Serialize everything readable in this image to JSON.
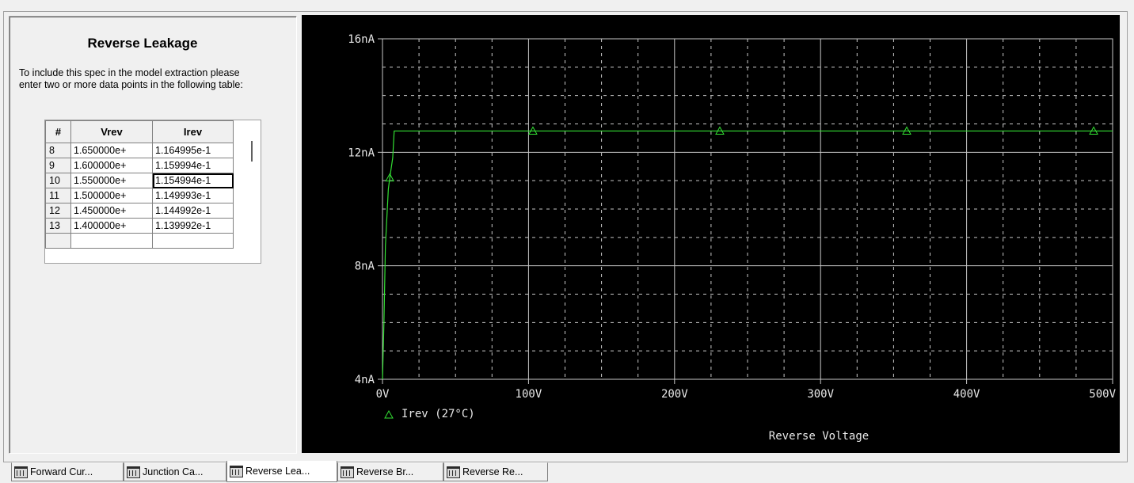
{
  "spec_panel": {
    "title": "Reverse Leakage",
    "description": "To include this spec in the model extraction please enter two or more data points in the following table:"
  },
  "data_table": {
    "columns": [
      "#",
      "Vrev",
      "Irev"
    ],
    "rows": [
      {
        "idx": "8",
        "vrev": "1.650000e+",
        "irev": "1.164995e-1"
      },
      {
        "idx": "9",
        "vrev": "1.600000e+",
        "irev": "1.159994e-1"
      },
      {
        "idx": "10",
        "vrev": "1.550000e+",
        "irev": "1.154994e-1"
      },
      {
        "idx": "11",
        "vrev": "1.500000e+",
        "irev": "1.149993e-1"
      },
      {
        "idx": "12",
        "vrev": "1.450000e+",
        "irev": "1.144992e-1"
      },
      {
        "idx": "13",
        "vrev": "1.400000e+",
        "irev": "1.139992e-1"
      }
    ],
    "selected_row": "10",
    "selected_column": "irev"
  },
  "chart_data": {
    "type": "line",
    "xlabel": "Reverse Voltage",
    "ylabel": "",
    "xlim": [
      0,
      500
    ],
    "ylim": [
      4,
      16
    ],
    "x_unit": "V",
    "y_unit": "nA",
    "x_ticks": [
      "0V",
      "100V",
      "200V",
      "300V",
      "400V",
      "500V"
    ],
    "y_ticks": [
      "4nA",
      "8nA",
      "12nA",
      "16nA"
    ],
    "grid": true,
    "legend_position": "bottom-left",
    "series": [
      {
        "name": "Irev (27°C)",
        "color": "#33e033",
        "marker": "triangle",
        "x": [
          0,
          1,
          2,
          4,
          5,
          7,
          8,
          100,
          200,
          300,
          400,
          500
        ],
        "y": [
          4.0,
          6.0,
          8.7,
          10.7,
          11.1,
          11.8,
          12.75,
          12.75,
          12.75,
          12.75,
          12.75,
          12.75
        ],
        "marker_x": [
          5,
          103,
          231,
          359,
          487
        ],
        "marker_y": [
          11.1,
          12.75,
          12.75,
          12.75,
          12.75
        ]
      }
    ],
    "background_color": "#000000",
    "grid_color": "#c8c8c8"
  },
  "tabs": [
    {
      "label": "Forward Cur...",
      "icon": "spec-sheet-icon"
    },
    {
      "label": "Junction Ca...",
      "icon": "spec-sheet-icon"
    },
    {
      "label": "Reverse Lea...",
      "icon": "spec-sheet-icon",
      "active": true
    },
    {
      "label": "Reverse Br...",
      "icon": "spec-sheet-icon"
    },
    {
      "label": "Reverse Re...",
      "icon": "spec-sheet-icon"
    }
  ]
}
